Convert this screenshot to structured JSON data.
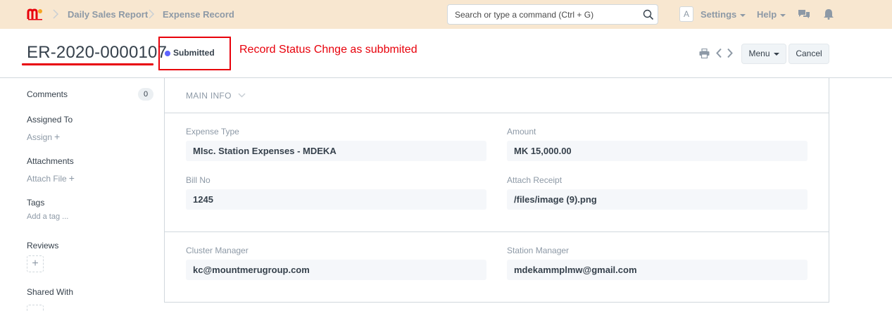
{
  "navbar": {
    "breadcrumbs": [
      "Daily Sales Report",
      "Expense Record"
    ],
    "search_placeholder": "Search or type a command (Ctrl + G)",
    "avatar_letter": "A",
    "settings_label": "Settings",
    "help_label": "Help",
    "accent_color": "#f8e7d0"
  },
  "page": {
    "title": "ER-2020-0000107",
    "status": "Submitted",
    "status_color": "#5e64ff",
    "annotation_text": "Record Status Chnge as subbmited",
    "annotation_color": "#e8000b",
    "menu_label": "Menu",
    "cancel_label": "Cancel"
  },
  "sidebar": {
    "comments_label": "Comments",
    "comments_count": "0",
    "assigned_label": "Assigned To",
    "assign_link": "Assign",
    "attachments_label": "Attachments",
    "attach_link": "Attach File",
    "tags_label": "Tags",
    "add_tag_link": "Add a tag ...",
    "reviews_label": "Reviews",
    "shared_label": "Shared With"
  },
  "form": {
    "section_title": "MAIN INFO",
    "fields": {
      "expense_type": {
        "label": "Expense Type",
        "value": "MIsc. Station Expenses - MDEKA"
      },
      "amount": {
        "label": "Amount",
        "value": "MK 15,000.00"
      },
      "bill_no": {
        "label": "Bill No",
        "value": "1245"
      },
      "attach_receipt": {
        "label": "Attach Receipt",
        "value": "/files/image (9).png"
      },
      "cluster_manager": {
        "label": "Cluster Manager",
        "value": "kc@mountmerugroup.com"
      },
      "station_manager": {
        "label": "Station Manager",
        "value": "mdekammplmw@gmail.com"
      }
    }
  }
}
